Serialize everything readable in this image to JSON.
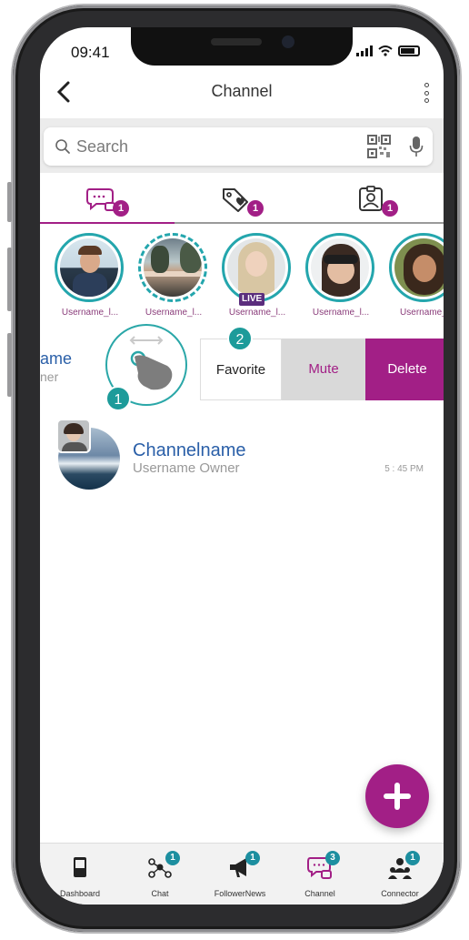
{
  "status": {
    "time": "09:41"
  },
  "header": {
    "title": "Channel"
  },
  "search": {
    "placeholder": "Search"
  },
  "tabs": [
    {
      "icon": "chat-bubbles-icon",
      "badge": "1",
      "active": true
    },
    {
      "icon": "heart-tag-icon",
      "badge": "1",
      "active": false
    },
    {
      "icon": "contact-badge-icon",
      "badge": "1",
      "active": false
    }
  ],
  "stories": [
    {
      "username": "Username_l...",
      "live": false
    },
    {
      "username": "Username_l...",
      "live": false
    },
    {
      "username": "Username_l...",
      "live": true
    },
    {
      "username": "Username_l...",
      "live": false
    },
    {
      "username": "Username_l",
      "live": false
    }
  ],
  "live_label": "LIVE",
  "swiped_row": {
    "name_fragment": "ame",
    "owner_fragment": "ner",
    "actions": {
      "favorite": "Favorite",
      "mute": "Mute",
      "delete": "Delete"
    }
  },
  "steps": {
    "one": "1",
    "two": "2"
  },
  "channel": {
    "name": "Channelname",
    "owner": "Username Owner",
    "time": "5 : 45 PM"
  },
  "bottom_nav": [
    {
      "label": "Dashboard",
      "icon": "dashboard-icon",
      "badge": ""
    },
    {
      "label": "Chat",
      "icon": "chat-network-icon",
      "badge": "1"
    },
    {
      "label": "FollowerNews",
      "icon": "megaphone-icon",
      "badge": "1"
    },
    {
      "label": "Channel",
      "icon": "channel-icon",
      "badge": "3"
    },
    {
      "label": "Connector",
      "icon": "connector-icon",
      "badge": "1"
    }
  ],
  "colors": {
    "accent": "#a21f86",
    "teal": "#24a6ad",
    "link_blue": "#2a5fa8"
  }
}
